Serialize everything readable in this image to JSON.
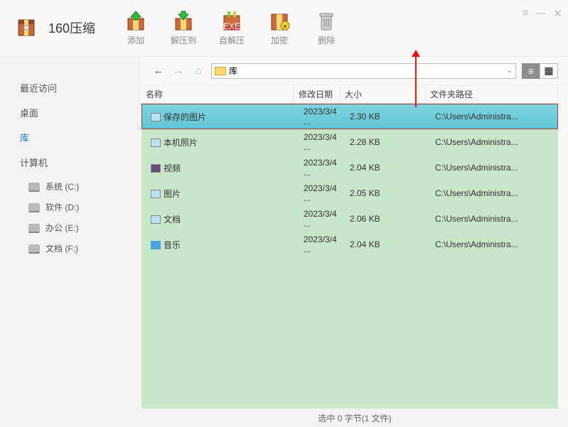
{
  "app_title": "160压缩",
  "toolbar": {
    "add": "添加",
    "extract_to": "解压到",
    "sfx": "自解压",
    "encrypt": "加密",
    "delete": "删除"
  },
  "win_controls": {
    "menu": "≡",
    "min": "—",
    "close": "✕"
  },
  "sidebar": {
    "recent": "最近访问",
    "desktop": "桌面",
    "library": "库",
    "computer": "计算机",
    "drives": [
      {
        "label": "系统 (C:)"
      },
      {
        "label": "软件 (D:)"
      },
      {
        "label": "办公 (E:)"
      },
      {
        "label": "文档 (F:)"
      }
    ]
  },
  "nav": {
    "path": "库"
  },
  "columns": {
    "name": "名称",
    "mod": "修改日期",
    "size": "大小",
    "folder": "文件夹路径"
  },
  "rows": [
    {
      "name": "保存的图片",
      "date": "2023/3/4 ...",
      "size": "2.30 KB",
      "path": "C:\\Users\\Administra...",
      "ico": "img",
      "selected": true
    },
    {
      "name": "本机照片",
      "date": "2023/3/4 ...",
      "size": "2.28 KB",
      "path": "C:\\Users\\Administra...",
      "ico": "img",
      "selected": false
    },
    {
      "name": "视频",
      "date": "2023/3/4 ...",
      "size": "2.04 KB",
      "path": "C:\\Users\\Administra...",
      "ico": "vid",
      "selected": false
    },
    {
      "name": "图片",
      "date": "2023/3/4 ...",
      "size": "2.05 KB",
      "path": "C:\\Users\\Administra...",
      "ico": "img",
      "selected": false
    },
    {
      "name": "文档",
      "date": "2023/3/4 ...",
      "size": "2.06 KB",
      "path": "C:\\Users\\Administra...",
      "ico": "img",
      "selected": false
    },
    {
      "name": "音乐",
      "date": "2023/3/4 ...",
      "size": "2.04 KB",
      "path": "C:\\Users\\Administra...",
      "ico": "mus",
      "selected": false
    }
  ],
  "status": "选中  0 字节(1 文件)"
}
